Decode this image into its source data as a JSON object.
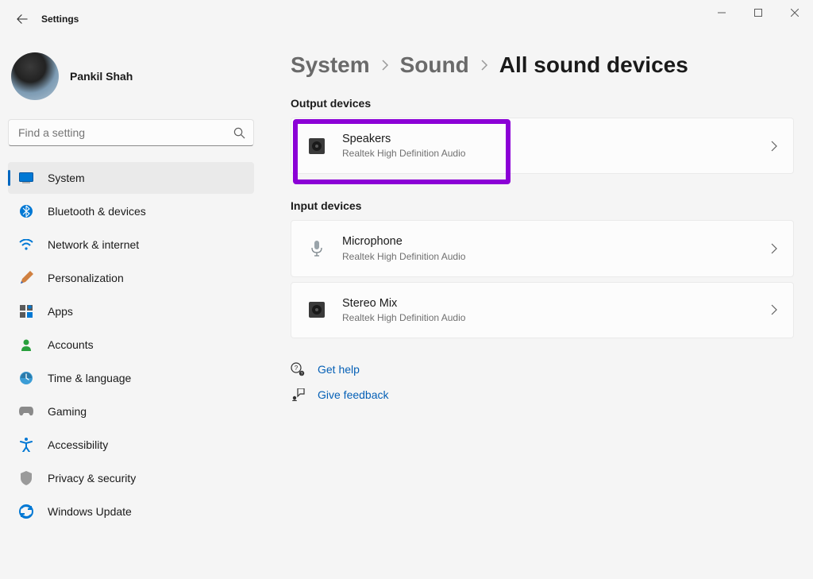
{
  "app_title": "Settings",
  "user": {
    "name": "Pankil Shah"
  },
  "search": {
    "placeholder": "Find a setting"
  },
  "sidebar": {
    "items": [
      {
        "label": "System",
        "icon": "system",
        "active": true
      },
      {
        "label": "Bluetooth & devices",
        "icon": "bluetooth"
      },
      {
        "label": "Network & internet",
        "icon": "wifi"
      },
      {
        "label": "Personalization",
        "icon": "personalization"
      },
      {
        "label": "Apps",
        "icon": "apps"
      },
      {
        "label": "Accounts",
        "icon": "accounts"
      },
      {
        "label": "Time & language",
        "icon": "time"
      },
      {
        "label": "Gaming",
        "icon": "gaming"
      },
      {
        "label": "Accessibility",
        "icon": "accessibility"
      },
      {
        "label": "Privacy & security",
        "icon": "privacy"
      },
      {
        "label": "Windows Update",
        "icon": "update"
      }
    ]
  },
  "breadcrumb": {
    "items": [
      "System",
      "Sound"
    ],
    "current": "All sound devices"
  },
  "sections": {
    "output": {
      "title": "Output devices",
      "devices": [
        {
          "name": "Speakers",
          "desc": "Realtek High Definition Audio",
          "highlighted": true
        }
      ]
    },
    "input": {
      "title": "Input devices",
      "devices": [
        {
          "name": "Microphone",
          "desc": "Realtek High Definition Audio"
        },
        {
          "name": "Stereo Mix",
          "desc": "Realtek High Definition Audio"
        }
      ]
    }
  },
  "footer": {
    "help": "Get help",
    "feedback": "Give feedback"
  }
}
